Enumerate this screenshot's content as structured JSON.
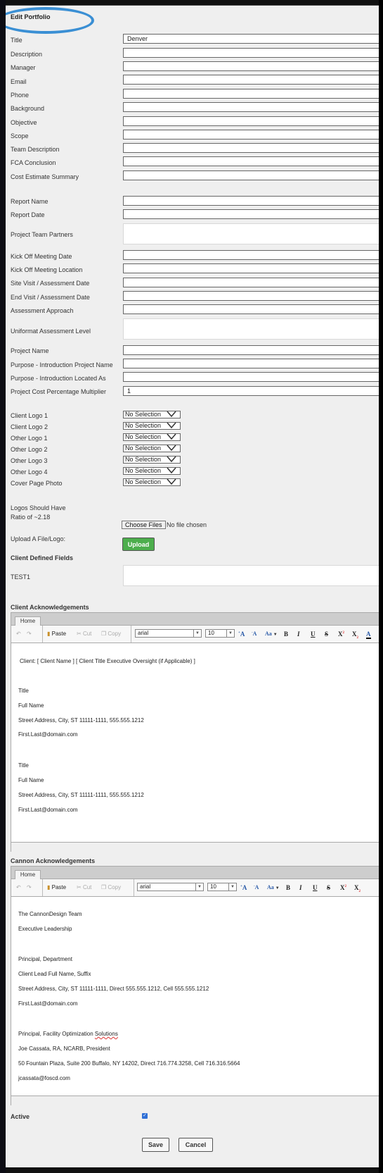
{
  "page": {
    "title": "Edit Portfolio",
    "highlight_color": "#3a8fd4"
  },
  "fields": [
    {
      "label": "Title",
      "value": "Denver",
      "type": "text"
    },
    {
      "label": "Description",
      "value": "",
      "type": "text"
    },
    {
      "label": "Manager",
      "value": "",
      "type": "text"
    },
    {
      "label": "Email",
      "value": "",
      "type": "text"
    },
    {
      "label": "Phone",
      "value": "",
      "type": "text"
    },
    {
      "label": "Background",
      "value": "",
      "type": "text"
    },
    {
      "label": "Objective",
      "value": "",
      "type": "text"
    },
    {
      "label": "Scope",
      "value": "",
      "type": "text"
    },
    {
      "label": "Team Description",
      "value": "",
      "type": "text"
    },
    {
      "label": "FCA Conclusion",
      "value": "",
      "type": "text"
    },
    {
      "label": "Cost Estimate Summary",
      "value": "",
      "type": "text"
    },
    {
      "label": "Report Name",
      "value": "",
      "type": "text"
    },
    {
      "label": "Report Date",
      "value": "",
      "type": "text"
    },
    {
      "label": "Project Team Partners",
      "value": "",
      "type": "textarea"
    },
    {
      "label": "Kick Off Meeting Date",
      "value": "",
      "type": "text"
    },
    {
      "label": "Kick Off Meeting Location",
      "value": "",
      "type": "text"
    },
    {
      "label": "Site Visit / Assessment Date",
      "value": "",
      "type": "text"
    },
    {
      "label": "End Visit / Assessment Date",
      "value": "",
      "type": "text"
    },
    {
      "label": "Assessment Approach",
      "value": "",
      "type": "text"
    },
    {
      "label": "Uniformat Assessment Level",
      "value": "",
      "type": "textarea"
    },
    {
      "label": "Project Name",
      "value": "",
      "type": "text"
    },
    {
      "label": "Purpose - Introduction Project Name",
      "value": "",
      "type": "text"
    },
    {
      "label": "Purpose - Introduction Located As",
      "value": "",
      "type": "text"
    },
    {
      "label": "Project Cost Percentage Multiplier",
      "value": "1",
      "type": "text"
    }
  ],
  "logos": [
    {
      "label": "Client Logo 1",
      "selected": "No Selection"
    },
    {
      "label": "Client Logo 2",
      "selected": "No Selection"
    },
    {
      "label": "Other Logo 1",
      "selected": "No Selection"
    },
    {
      "label": "Other Logo 2",
      "selected": "No Selection"
    },
    {
      "label": "Other Logo 3",
      "selected": "No Selection"
    },
    {
      "label": "Other Logo 4",
      "selected": "No Selection"
    },
    {
      "label": "Cover Page Photo",
      "selected": "No Selection"
    }
  ],
  "logo_note": {
    "line1": "Logos Should Have",
    "line2": "Ratio of ~2.18"
  },
  "upload": {
    "label": "Upload A File/Logo:",
    "choose_label": "Choose Files",
    "status": "No file chosen",
    "button_label": "Upload",
    "button_color": "#4cae4c"
  },
  "client_defined": {
    "heading": "Client Defined Fields",
    "fields": [
      {
        "label": "TEST1",
        "value": ""
      }
    ]
  },
  "toolbar": {
    "tab": "Home",
    "paste": "Paste",
    "cut": "Cut",
    "copy": "Copy",
    "font": "arial",
    "size": "10",
    "grow": "A",
    "shrink": "A",
    "case": "Aa",
    "bold": "B",
    "italic": "I",
    "underline": "U",
    "strike": "S",
    "superscript": "X",
    "subscript": "X"
  },
  "client_ack": {
    "heading": "Client Acknowledgements",
    "lines": [
      "Client:  [ Client Name ] [ Client Title Executive Oversight (if Applicable) ]",
      "Title",
      "Full Name",
      "Street Address, City, ST 11111-1111, 555.555.1212",
      "First.Last@domain.com",
      "Title",
      "Full Name",
      "Street Address, City, ST 11111-1111, 555.555.1212",
      "First.Last@domain.com"
    ]
  },
  "cannon_ack": {
    "heading": "Cannon Acknowledgements",
    "lines": [
      "The CannonDesign Team",
      "Executive Leadership",
      "Principal, Department",
      "Client Lead Full Name, Suffix",
      "Street Address, City, ST 11111-1111, Direct 555.555.1212, Cell 555.555.1212",
      "First.Last@domain.com",
      "Principal, Facility Optimization ",
      "Solutions",
      "Joe Cassata, RA, NCARB, President",
      "50 Fountain Plaza, Suite 200 Buffalo, NY 14202, Direct 716.774.3258, Cell 716.316.5664",
      "jcassata@foscd.com"
    ]
  },
  "active": {
    "label": "Active",
    "checked": true
  },
  "actions": {
    "save": "Save",
    "cancel": "Cancel"
  }
}
